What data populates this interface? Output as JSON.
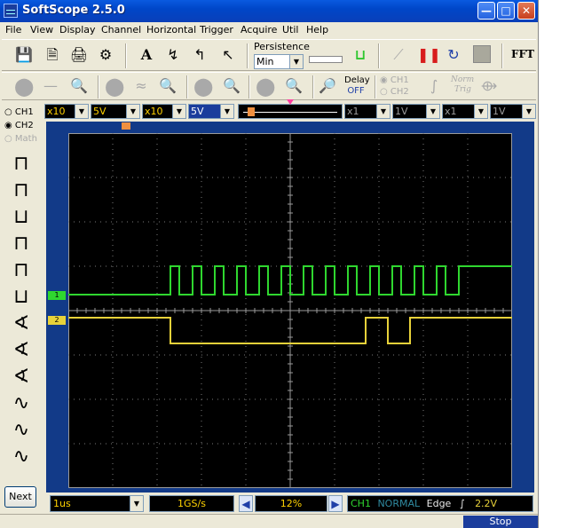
{
  "window": {
    "title": "SoftScope 2.5.0"
  },
  "menu": [
    "File",
    "View",
    "Display",
    "Channel",
    "Horizontal",
    "Trigger",
    "Acquire",
    "Util",
    "Help"
  ],
  "toolbar": {
    "persistence_label": "Persistence",
    "persistence_value": "Min",
    "delay_label": "Delay",
    "delay_value": "OFF",
    "radio_ch1": "CH1",
    "radio_ch2": "CH2",
    "norm_label": "Norm",
    "trig_label": "Trig",
    "fft_label": "FFT"
  },
  "channel_select": {
    "ch1": "CH1",
    "ch2": "CH2",
    "math": "Math"
  },
  "controls": {
    "ch1_probe": "x10",
    "ch1_volts": "5V",
    "ch2_probe": "x10",
    "ch2_volts": "5V",
    "math1_probe": "x1",
    "math1_volts": "1V",
    "math2_probe": "x1",
    "math2_volts": "1V"
  },
  "bottom": {
    "timebase": "1us",
    "sample_rate": "1GS/s",
    "position": "12%",
    "trigger_source": "CH1",
    "trigger_mode": "NORMAL",
    "trigger_type": "Edge",
    "trigger_level": "2.2V",
    "state": "Stop"
  },
  "left": {
    "next_label": "Next"
  },
  "markers": {
    "ch1": "1",
    "ch2": "2"
  },
  "colors": {
    "ch1": "#2fd72f",
    "ch2": "#e8d23a",
    "accent": "#0a4ddb"
  },
  "chart_data": {
    "type": "line",
    "grid": true,
    "x_divisions": 10,
    "y_divisions": 8,
    "series": [
      {
        "name": "1",
        "color": "#2fd72f",
        "x": [
          0,
          2.3,
          2.3,
          2.5,
          2.5,
          2.8,
          2.8,
          3.0,
          3.0,
          3.3,
          3.3,
          3.5,
          3.5,
          3.8,
          3.8,
          4.0,
          4.0,
          4.3,
          4.3,
          4.5,
          4.5,
          4.8,
          4.8,
          5.0,
          5.0,
          5.3,
          5.3,
          5.5,
          5.5,
          5.8,
          5.8,
          6.0,
          6.0,
          6.3,
          6.3,
          6.5,
          6.5,
          6.8,
          6.8,
          7.0,
          7.0,
          7.3,
          7.3,
          7.5,
          7.5,
          7.8,
          7.8,
          8.0,
          8.0,
          8.3,
          8.3,
          8.5,
          8.5,
          8.8,
          8.8,
          10
        ],
        "y": [
          0,
          0,
          1,
          1,
          0,
          0,
          1,
          1,
          0,
          0,
          1,
          1,
          0,
          0,
          1,
          1,
          0,
          0,
          1,
          1,
          0,
          0,
          1,
          1,
          0,
          0,
          1,
          1,
          0,
          0,
          1,
          1,
          0,
          0,
          1,
          1,
          0,
          0,
          1,
          1,
          0,
          0,
          1,
          1,
          0,
          0,
          1,
          1,
          0,
          0,
          1,
          1,
          0,
          0,
          1,
          1
        ]
      },
      {
        "name": "2",
        "color": "#e8d23a",
        "x": [
          0,
          2.3,
          2.3,
          6.7,
          6.7,
          7.2,
          7.2,
          7.7,
          7.7,
          10
        ],
        "y": [
          1,
          1,
          0,
          0,
          1,
          1,
          0,
          0,
          1,
          1
        ]
      }
    ]
  }
}
